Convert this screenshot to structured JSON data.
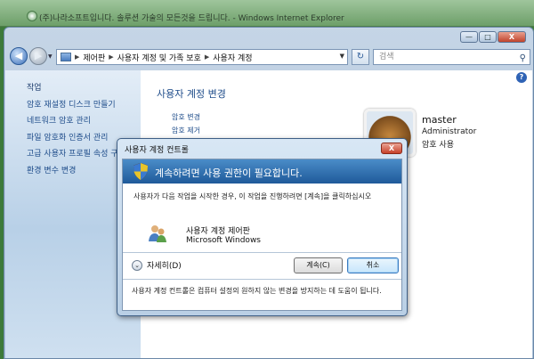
{
  "background_window": {
    "title": "(주)나라소프트입니다. 솔루션 가술의 모든것을 드립니다. - Windows Internet Explorer"
  },
  "window": {
    "caption_buttons": {
      "minimize": "—",
      "maximize": "□",
      "close": "X"
    },
    "address_crumbs": [
      "제어판",
      "사용자 계정 및 가족 보호",
      "사용자 계정"
    ],
    "search_placeholder": "검색"
  },
  "sidebar": {
    "title": "작업",
    "items": [
      "암호 재설정 디스크 만들기",
      "네트워크 암호 관리",
      "파일 암호화 인증서 관리",
      "고급 사용자 프로필 속성 구성",
      "환경 변수 변경"
    ]
  },
  "main": {
    "title": "사용자 계정 변경",
    "links": [
      "암호 변경",
      "암호 제거"
    ]
  },
  "user": {
    "name": "master",
    "role": "Administrator",
    "password_status": "암호 사용"
  },
  "dialog": {
    "title": "사용자 계정 컨트롤",
    "close": "X",
    "banner": "계속하려면 사용 권한이 필요합니다.",
    "message": "사용자가 다음 작업을 시작한 경우, 이 작업을 진행하려면 [계속]을 클릭하십시오",
    "program_name": "사용자 계정 제어판",
    "publisher": "Microsoft Windows",
    "details_label": "자세히(D)",
    "continue_label": "계속(C)",
    "cancel_label": "취소",
    "footer": "사용자 계정 컨트롤은 컴퓨터 설정의 원하지 않는 변경을 방지하는 데 도움이 됩니다."
  }
}
